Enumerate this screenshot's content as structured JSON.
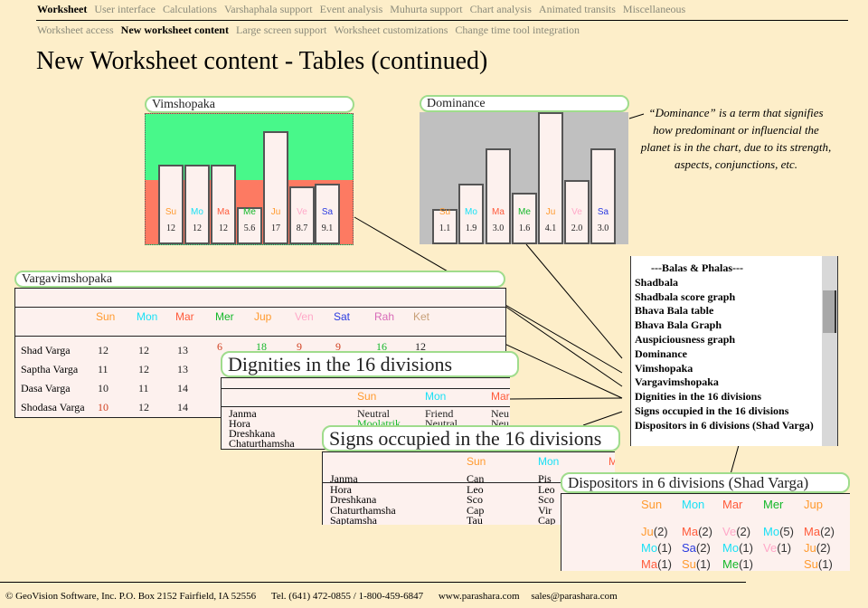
{
  "nav": {
    "primary": [
      "Worksheet",
      "User interface",
      "Calculations",
      "Varshaphala support",
      "Event analysis",
      "Muhurta support",
      "Chart analysis",
      "Animated transits",
      "Miscellaneous"
    ],
    "primary_active": 0,
    "secondary": [
      "Worksheet access",
      "New worksheet content",
      "Large screen support",
      "Worksheet customizations",
      "Change time tool integration"
    ],
    "secondary_active": 1
  },
  "page_title": "New Worksheet content - Tables (continued)",
  "planet_colors": {
    "Su": "#ff9a2e",
    "Mo": "#19e0f5",
    "Ma": "#ff5a3a",
    "Me": "#14b82a",
    "Ju": "#ff9a2e",
    "Ve": "#ffa8c8",
    "Sa": "#2a3ae0",
    "Ra": "#d86ab8",
    "Ke": "#c8a078"
  },
  "vimshopaka": {
    "title": "Vimshopaka",
    "colors": {
      "upper": "#48f88a",
      "lower": "#fd7a62"
    },
    "bars": [
      {
        "label": "Su",
        "value": 12
      },
      {
        "label": "Mo",
        "value": 12
      },
      {
        "label": "Ma",
        "value": 12
      },
      {
        "label": "Me",
        "value": 5.6
      },
      {
        "label": "Ju",
        "value": 17
      },
      {
        "label": "Ve",
        "value": 8.7
      },
      {
        "label": "Sa",
        "value": 9.1
      }
    ]
  },
  "dominance": {
    "title": "Dominance",
    "bg": "#c0c0c0",
    "bars": [
      {
        "label": "Su",
        "value": "1.1"
      },
      {
        "label": "Mo",
        "value": "1.9"
      },
      {
        "label": "Ma",
        "value": "3.0"
      },
      {
        "label": "Me",
        "value": "1.6"
      },
      {
        "label": "Ju",
        "value": "4.1"
      },
      {
        "label": "Ve",
        "value": "2.0"
      },
      {
        "label": "Sa",
        "value": "3.0"
      }
    ]
  },
  "annotation": "“Dominance” is a term that signifies how predominant or influencial the planet is in the chart, due to its strength, aspects, conjunctions, etc.",
  "vargavimshopaka": {
    "title": "Vargavimshopaka",
    "headers": [
      {
        "t": "Sun",
        "c": "Su"
      },
      {
        "t": "Mon",
        "c": "Mo"
      },
      {
        "t": "Mar",
        "c": "Ma"
      },
      {
        "t": "Mer",
        "c": "Me"
      },
      {
        "t": "Jup",
        "c": "Ju"
      },
      {
        "t": "Ven",
        "c": "Ve"
      },
      {
        "t": "Sat",
        "c": "Sa"
      },
      {
        "t": "Rah",
        "c": "Ra"
      },
      {
        "t": "Ket",
        "c": "Ke"
      }
    ],
    "rows": [
      {
        "label": "Shad Varga",
        "values": [
          "12",
          "12",
          "13",
          "6",
          "18",
          "9",
          "9",
          "16",
          "12"
        ]
      },
      {
        "label": "Saptha Varga",
        "values": [
          "11",
          "12",
          "13"
        ]
      },
      {
        "label": "Dasa Varga",
        "values": [
          "10",
          "11",
          "14"
        ]
      },
      {
        "label": "Shodasa Varga",
        "values": [
          "10",
          "12",
          "14"
        ]
      }
    ]
  },
  "dignities": {
    "title": "Dignities in the 16 divisions",
    "headers": [
      "Sun",
      "Mon",
      "Mar"
    ],
    "rows": [
      {
        "label": "Janma",
        "values": [
          "Neutral",
          "Friend",
          "Neu"
        ]
      },
      {
        "label": "Hora",
        "values": [
          "Moolatrik",
          "Neutral",
          "Neu"
        ]
      },
      {
        "label": "Dreshkana",
        "values": []
      },
      {
        "label": "Chaturthamsha",
        "values": []
      }
    ]
  },
  "signs": {
    "title": "Signs occupied in the 16 divisions",
    "headers": [
      "Sun",
      "Mon",
      "M"
    ],
    "rows": [
      {
        "label": "Janma",
        "values": [
          "Can",
          "Pis"
        ]
      },
      {
        "label": "Hora",
        "values": [
          "Leo",
          "Leo"
        ]
      },
      {
        "label": "Dreshkana",
        "values": [
          "Sco",
          "Sco"
        ]
      },
      {
        "label": "Chaturthamsha",
        "values": [
          "Cap",
          "Vir"
        ]
      },
      {
        "label": "Saptamsha",
        "values": [
          "Tau",
          "Cap"
        ]
      }
    ]
  },
  "dispositors": {
    "title": "Dispositors in 6 divisions (Shad Varga)",
    "headers": [
      "Sun",
      "Mon",
      "Mar",
      "Mer",
      "Jup"
    ],
    "columns": [
      [
        {
          "p": "Ju",
          "n": "(2)"
        },
        {
          "p": "Mo",
          "n": "(1)"
        },
        {
          "p": "Ma",
          "n": "(1)"
        }
      ],
      [
        {
          "p": "Ma",
          "n": "(2)"
        },
        {
          "p": "Sa",
          "n": "(2)"
        },
        {
          "p": "Su",
          "n": "(1)"
        }
      ],
      [
        {
          "p": "Ve",
          "n": "(2)"
        },
        {
          "p": "Mo",
          "n": "(1)"
        },
        {
          "p": "Me",
          "n": "(1)"
        }
      ],
      [
        {
          "p": "Mo",
          "n": "(5)"
        },
        {
          "p": "Ve",
          "n": "(1)"
        }
      ],
      [
        {
          "p": "Ma",
          "n": "(2)"
        },
        {
          "p": "Ju",
          "n": "(2)"
        },
        {
          "p": "Su",
          "n": "(1)"
        }
      ]
    ]
  },
  "listbox": {
    "items": [
      "---Balas & Phalas---",
      "Shadbala",
      "Shadbala score graph",
      "Bhava Bala table",
      "Bhava Bala Graph",
      "Auspiciousness graph",
      "Dominance",
      "Vimshopaka",
      "Vargavimshopaka",
      "Dignities in the 16 divisions",
      "Signs occupied in the 16 divisions",
      "Dispositors in 6 divisions (Shad Varga)"
    ]
  },
  "footer": {
    "company": "© GeoVision Software, Inc. P.O. Box 2152 Fairfield, IA 52556",
    "phone": "Tel. (641) 472-0855 / 1-800-459-6847",
    "website": "www.parashara.com",
    "email": "sales@parashara.com"
  }
}
